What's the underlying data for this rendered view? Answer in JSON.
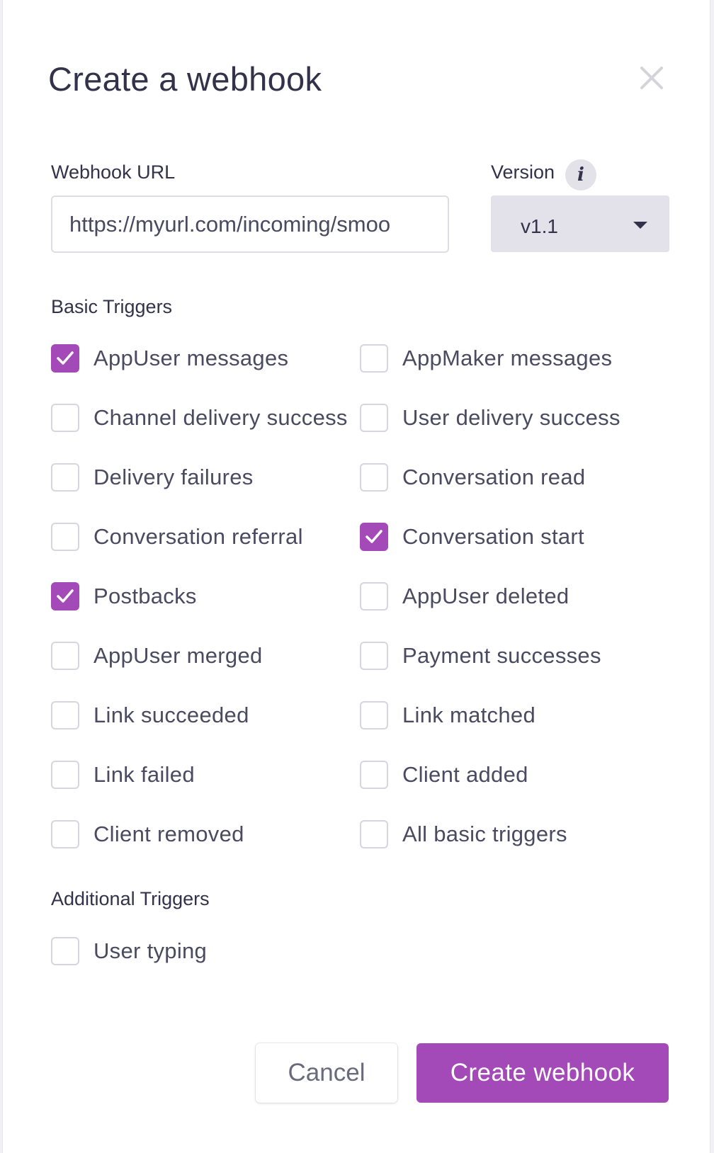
{
  "modal": {
    "title": "Create a webhook",
    "close_icon": "close-icon"
  },
  "webhook_url": {
    "label": "Webhook URL",
    "value": "https://myurl.com/incoming/smoo"
  },
  "version": {
    "label": "Version",
    "info_icon_glyph": "i",
    "selected": "v1.1"
  },
  "basic_triggers": {
    "title": "Basic Triggers",
    "items": [
      {
        "label": "AppUser messages",
        "checked": true
      },
      {
        "label": "AppMaker messages",
        "checked": false
      },
      {
        "label": "Channel delivery success",
        "checked": false
      },
      {
        "label": "User delivery success",
        "checked": false
      },
      {
        "label": "Delivery failures",
        "checked": false
      },
      {
        "label": "Conversation read",
        "checked": false
      },
      {
        "label": "Conversation referral",
        "checked": false
      },
      {
        "label": "Conversation start",
        "checked": true
      },
      {
        "label": "Postbacks",
        "checked": true
      },
      {
        "label": "AppUser deleted",
        "checked": false
      },
      {
        "label": "AppUser merged",
        "checked": false
      },
      {
        "label": "Payment successes",
        "checked": false
      },
      {
        "label": "Link succeeded",
        "checked": false
      },
      {
        "label": "Link matched",
        "checked": false
      },
      {
        "label": "Link failed",
        "checked": false
      },
      {
        "label": "Client added",
        "checked": false
      },
      {
        "label": "Client removed",
        "checked": false
      },
      {
        "label": "All basic triggers",
        "checked": false
      }
    ]
  },
  "additional_triggers": {
    "title": "Additional Triggers",
    "items": [
      {
        "label": "User typing",
        "checked": false
      }
    ]
  },
  "footer": {
    "cancel_label": "Cancel",
    "create_label": "Create webhook"
  },
  "colors": {
    "accent": "#a34ab8",
    "text": "#33324a",
    "border": "#d7d5de"
  }
}
